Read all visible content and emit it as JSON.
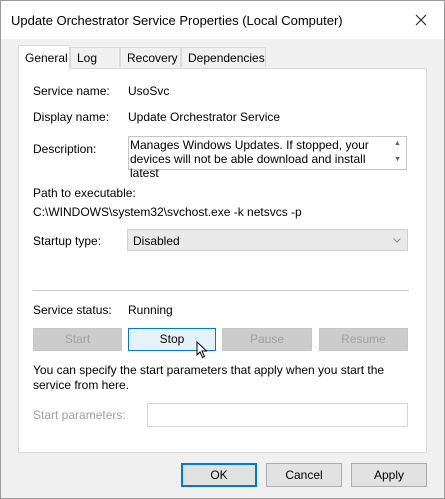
{
  "window": {
    "title": "Update Orchestrator Service Properties (Local Computer)"
  },
  "tabs": [
    {
      "label": "General",
      "active": true
    },
    {
      "label": "Log On",
      "active": false
    },
    {
      "label": "Recovery",
      "active": false
    },
    {
      "label": "Dependencies",
      "active": false
    }
  ],
  "general": {
    "service_name_label": "Service name:",
    "service_name": "UsoSvc",
    "display_name_label": "Display name:",
    "display_name": "Update Orchestrator Service",
    "description_label": "Description:",
    "description": "Manages Windows Updates. If stopped, your devices will not be able download and install latest",
    "path_label": "Path to executable:",
    "path": "C:\\WINDOWS\\system32\\svchost.exe -k netsvcs -p",
    "startup_type_label": "Startup type:",
    "startup_type": "Disabled",
    "service_status_label": "Service status:",
    "service_status": "Running",
    "buttons": {
      "start": "Start",
      "stop": "Stop",
      "pause": "Pause",
      "resume": "Resume"
    },
    "hint": "You can specify the start parameters that apply when you start the service from here.",
    "start_params_label": "Start parameters:",
    "start_params_value": ""
  },
  "footer": {
    "ok": "OK",
    "cancel": "Cancel",
    "apply": "Apply"
  },
  "icons": {
    "close": "close-icon",
    "chevron_down": "chevron-down-icon",
    "scroll_up": "scroll-up-icon",
    "scroll_down": "scroll-down-icon",
    "cursor": "mouse-pointer-icon"
  },
  "colors": {
    "accent": "#0078d7",
    "window_bg": "#f0f0f0",
    "disabled_text": "#a0a0a0"
  }
}
